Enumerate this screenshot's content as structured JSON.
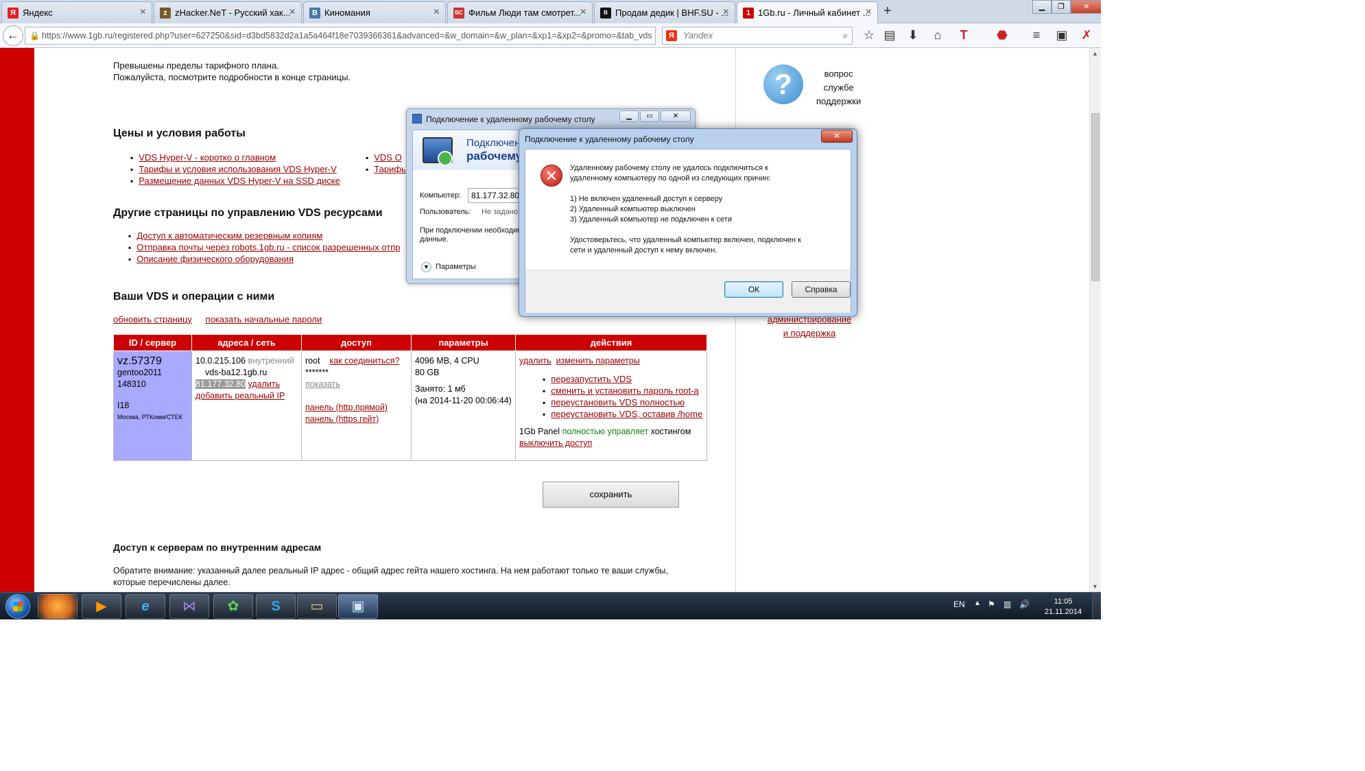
{
  "browser": {
    "tabs": [
      {
        "label": "Яндекс",
        "icon": "yandex-icon",
        "color": "#e31e24",
        "glyph": "Я"
      },
      {
        "label": "zHacker.NeT - Русский хак...",
        "icon": "zhacker-icon",
        "color": "#7a5a2a",
        "glyph": "z"
      },
      {
        "label": "Киномания",
        "icon": "vk-icon",
        "color": "#4a76a8",
        "glyph": "В"
      },
      {
        "label": "Фильм Люди там смотрет...",
        "icon": "bc-icon",
        "color": "#cc3333",
        "glyph": "BC"
      },
      {
        "label": "Продам дедик | BHF.SU - ...",
        "icon": "bhf-icon",
        "color": "#111111",
        "glyph": "B"
      },
      {
        "label": "1Gb.ru - Личный кабинет ...",
        "icon": "1gb-icon",
        "color": "#cc0000",
        "glyph": "1"
      }
    ],
    "new_tab": "+",
    "url": "https://www.1gb.ru/registered.php?user=627250&sid=d3bd5832d2a1a5a464f18e7039366361&advanced=&w_domain=&w_plan=&xp1=&xp2=&promo=&tab_vds",
    "search_engine": "Я",
    "search_placeholder": "Yandex"
  },
  "page": {
    "notice_line1": "Превышены пределы тарифного плана.",
    "notice_line2": "Пожалуйста, посмотрите подробности в конце страницы.",
    "prices_heading": "Цены и условия работы",
    "prices_links_left": [
      "VDS Hyper-V - коротко о главном",
      "Тарифы и условия использования VDS Hyper-V",
      "Размещение данных VDS Hyper-V на SSD диске"
    ],
    "prices_links_right": [
      "VDS O",
      "Тарифы"
    ],
    "other_heading": "Другие страницы по управлению VDS ресурсами",
    "other_links": [
      "Доступ к автоматическим резервным копиям",
      "Отправка почты через robots.1gb.ru - список разрешенных отпр",
      "Описание физического оборудования"
    ],
    "vds_heading": "Ваши VDS и операции с ними",
    "refresh_link": "обновить страницу",
    "show_passwords_link": "показать начальные пароли",
    "table": {
      "headers": [
        "ID / сервер",
        "адреса / сеть",
        "доступ",
        "параметры",
        "действия"
      ],
      "id": {
        "vz": "vz.57379",
        "os": "gentoo2011",
        "num": "148310",
        "loc": "I18",
        "dc": "Москва, РТКомм/СТЕК"
      },
      "addr": {
        "internal_ip": "10.0.215.106",
        "internal_label": "внутренний",
        "host": "vds-ba12.1gb.ru",
        "real_ip": "81.177.32.80",
        "delete": "удалить",
        "add_ip": "добавить реальный IP"
      },
      "access": {
        "user": "root",
        "how": "как соединиться?",
        "password": "*******",
        "show": "показать",
        "panel_direct": "панель (http.прямой)",
        "panel_gate": "панель (https.гейт)"
      },
      "params": {
        "ram_cpu": "4096 MB, 4 CPU",
        "disk": "80 GB",
        "used": "Занято: 1 мб",
        "date": "(на 2014-11-20 00:06:44)"
      },
      "actions": {
        "delete": "удалить",
        "change": "изменить параметры",
        "items": [
          "перезапустить VDS",
          "сменить и установить пароль root-a",
          "переустановить VDS полностью",
          "переустановить VDS, оставив /home"
        ],
        "panel_a": "1Gb Panel",
        "panel_b": "полностью управляет",
        "panel_c": "хостингом",
        "disable": "выключить доступ"
      }
    },
    "save_button": "сохранить",
    "internal_heading": "Доступ к серверам по внутренним адресам",
    "internal_text1": "Обратите внимание: указанный далее реальный IP адрес - общий адрес гейта нашего хостинга. На нем работают только те ваши службы,",
    "internal_text2": "которые перечислены далее.",
    "support": {
      "line1": "вопрос",
      "line2": "службе",
      "line3": "поддержки",
      "icon_glyph": "?"
    },
    "admin_links": [
      "администрирование",
      "и поддержка"
    ]
  },
  "rdp_window": {
    "title": "Подключение к удаленному рабочему столу",
    "head1": "Подключение",
    "head2": "рабочему",
    "computer_label": "Компьютер:",
    "computer_value": "81.177.32.80",
    "user_label": "Пользователь:",
    "user_value": "Не задано",
    "note_line1": "При подключении необходим",
    "note_line2": "данные.",
    "options": "Параметры"
  },
  "error_dialog": {
    "title": "Подключение к удаленному рабочему столу",
    "close_glyph": "✕",
    "icon_glyph": "✕",
    "line1": "Удаленному рабочему столу не удалось подключиться к",
    "line2": "удаленному компьютеру по одной из следующих причин:",
    "reason1": "1) Не включен удаленный доступ к серверу",
    "reason2": "2) Удаленный компьютер выключен",
    "reason3": "3) Удаленный компьютер не подключен к сети",
    "hint1": "Удостоверьтесь, что удаленный компьютер включен, подключен к",
    "hint2": "сети и удаленный доступ к нему включен.",
    "ok": "ОК",
    "help": "Справка"
  },
  "taskbar": {
    "lang": "EN",
    "time": "11:05",
    "date": "21.11.2014",
    "apps": [
      "firefox-icon",
      "media-player-icon",
      "ie-icon",
      "visual-studio-icon",
      "icq-icon",
      "skype-icon",
      "explorer-icon",
      "remote-desktop-icon"
    ]
  }
}
